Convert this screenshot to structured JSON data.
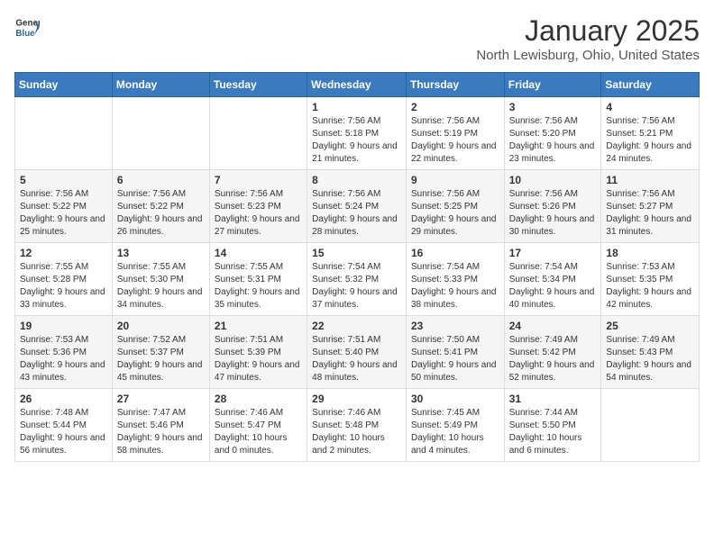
{
  "header": {
    "logo_general": "General",
    "logo_blue": "Blue",
    "month": "January 2025",
    "location": "North Lewisburg, Ohio, United States"
  },
  "weekdays": [
    "Sunday",
    "Monday",
    "Tuesday",
    "Wednesday",
    "Thursday",
    "Friday",
    "Saturday"
  ],
  "weeks": [
    [
      {
        "day": "",
        "sunrise": "",
        "sunset": "",
        "daylight": ""
      },
      {
        "day": "",
        "sunrise": "",
        "sunset": "",
        "daylight": ""
      },
      {
        "day": "",
        "sunrise": "",
        "sunset": "",
        "daylight": ""
      },
      {
        "day": "1",
        "sunrise": "Sunrise: 7:56 AM",
        "sunset": "Sunset: 5:18 PM",
        "daylight": "Daylight: 9 hours and 21 minutes."
      },
      {
        "day": "2",
        "sunrise": "Sunrise: 7:56 AM",
        "sunset": "Sunset: 5:19 PM",
        "daylight": "Daylight: 9 hours and 22 minutes."
      },
      {
        "day": "3",
        "sunrise": "Sunrise: 7:56 AM",
        "sunset": "Sunset: 5:20 PM",
        "daylight": "Daylight: 9 hours and 23 minutes."
      },
      {
        "day": "4",
        "sunrise": "Sunrise: 7:56 AM",
        "sunset": "Sunset: 5:21 PM",
        "daylight": "Daylight: 9 hours and 24 minutes."
      }
    ],
    [
      {
        "day": "5",
        "sunrise": "Sunrise: 7:56 AM",
        "sunset": "Sunset: 5:22 PM",
        "daylight": "Daylight: 9 hours and 25 minutes."
      },
      {
        "day": "6",
        "sunrise": "Sunrise: 7:56 AM",
        "sunset": "Sunset: 5:22 PM",
        "daylight": "Daylight: 9 hours and 26 minutes."
      },
      {
        "day": "7",
        "sunrise": "Sunrise: 7:56 AM",
        "sunset": "Sunset: 5:23 PM",
        "daylight": "Daylight: 9 hours and 27 minutes."
      },
      {
        "day": "8",
        "sunrise": "Sunrise: 7:56 AM",
        "sunset": "Sunset: 5:24 PM",
        "daylight": "Daylight: 9 hours and 28 minutes."
      },
      {
        "day": "9",
        "sunrise": "Sunrise: 7:56 AM",
        "sunset": "Sunset: 5:25 PM",
        "daylight": "Daylight: 9 hours and 29 minutes."
      },
      {
        "day": "10",
        "sunrise": "Sunrise: 7:56 AM",
        "sunset": "Sunset: 5:26 PM",
        "daylight": "Daylight: 9 hours and 30 minutes."
      },
      {
        "day": "11",
        "sunrise": "Sunrise: 7:56 AM",
        "sunset": "Sunset: 5:27 PM",
        "daylight": "Daylight: 9 hours and 31 minutes."
      }
    ],
    [
      {
        "day": "12",
        "sunrise": "Sunrise: 7:55 AM",
        "sunset": "Sunset: 5:28 PM",
        "daylight": "Daylight: 9 hours and 33 minutes."
      },
      {
        "day": "13",
        "sunrise": "Sunrise: 7:55 AM",
        "sunset": "Sunset: 5:30 PM",
        "daylight": "Daylight: 9 hours and 34 minutes."
      },
      {
        "day": "14",
        "sunrise": "Sunrise: 7:55 AM",
        "sunset": "Sunset: 5:31 PM",
        "daylight": "Daylight: 9 hours and 35 minutes."
      },
      {
        "day": "15",
        "sunrise": "Sunrise: 7:54 AM",
        "sunset": "Sunset: 5:32 PM",
        "daylight": "Daylight: 9 hours and 37 minutes."
      },
      {
        "day": "16",
        "sunrise": "Sunrise: 7:54 AM",
        "sunset": "Sunset: 5:33 PM",
        "daylight": "Daylight: 9 hours and 38 minutes."
      },
      {
        "day": "17",
        "sunrise": "Sunrise: 7:54 AM",
        "sunset": "Sunset: 5:34 PM",
        "daylight": "Daylight: 9 hours and 40 minutes."
      },
      {
        "day": "18",
        "sunrise": "Sunrise: 7:53 AM",
        "sunset": "Sunset: 5:35 PM",
        "daylight": "Daylight: 9 hours and 42 minutes."
      }
    ],
    [
      {
        "day": "19",
        "sunrise": "Sunrise: 7:53 AM",
        "sunset": "Sunset: 5:36 PM",
        "daylight": "Daylight: 9 hours and 43 minutes."
      },
      {
        "day": "20",
        "sunrise": "Sunrise: 7:52 AM",
        "sunset": "Sunset: 5:37 PM",
        "daylight": "Daylight: 9 hours and 45 minutes."
      },
      {
        "day": "21",
        "sunrise": "Sunrise: 7:51 AM",
        "sunset": "Sunset: 5:39 PM",
        "daylight": "Daylight: 9 hours and 47 minutes."
      },
      {
        "day": "22",
        "sunrise": "Sunrise: 7:51 AM",
        "sunset": "Sunset: 5:40 PM",
        "daylight": "Daylight: 9 hours and 48 minutes."
      },
      {
        "day": "23",
        "sunrise": "Sunrise: 7:50 AM",
        "sunset": "Sunset: 5:41 PM",
        "daylight": "Daylight: 9 hours and 50 minutes."
      },
      {
        "day": "24",
        "sunrise": "Sunrise: 7:49 AM",
        "sunset": "Sunset: 5:42 PM",
        "daylight": "Daylight: 9 hours and 52 minutes."
      },
      {
        "day": "25",
        "sunrise": "Sunrise: 7:49 AM",
        "sunset": "Sunset: 5:43 PM",
        "daylight": "Daylight: 9 hours and 54 minutes."
      }
    ],
    [
      {
        "day": "26",
        "sunrise": "Sunrise: 7:48 AM",
        "sunset": "Sunset: 5:44 PM",
        "daylight": "Daylight: 9 hours and 56 minutes."
      },
      {
        "day": "27",
        "sunrise": "Sunrise: 7:47 AM",
        "sunset": "Sunset: 5:46 PM",
        "daylight": "Daylight: 9 hours and 58 minutes."
      },
      {
        "day": "28",
        "sunrise": "Sunrise: 7:46 AM",
        "sunset": "Sunset: 5:47 PM",
        "daylight": "Daylight: 10 hours and 0 minutes."
      },
      {
        "day": "29",
        "sunrise": "Sunrise: 7:46 AM",
        "sunset": "Sunset: 5:48 PM",
        "daylight": "Daylight: 10 hours and 2 minutes."
      },
      {
        "day": "30",
        "sunrise": "Sunrise: 7:45 AM",
        "sunset": "Sunset: 5:49 PM",
        "daylight": "Daylight: 10 hours and 4 minutes."
      },
      {
        "day": "31",
        "sunrise": "Sunrise: 7:44 AM",
        "sunset": "Sunset: 5:50 PM",
        "daylight": "Daylight: 10 hours and 6 minutes."
      },
      {
        "day": "",
        "sunrise": "",
        "sunset": "",
        "daylight": ""
      }
    ]
  ]
}
